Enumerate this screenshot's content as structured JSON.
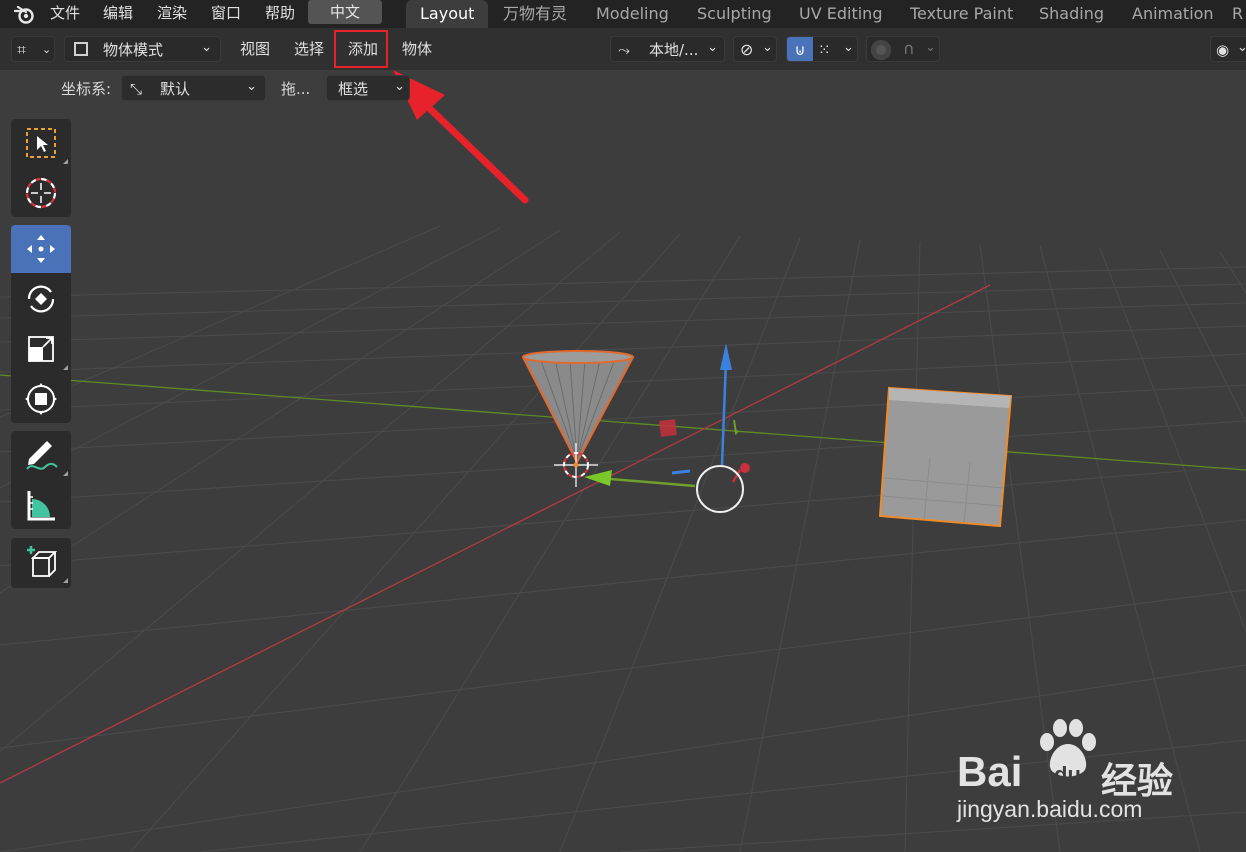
{
  "topbar": {
    "menus": [
      "文件",
      "编辑",
      "渲染",
      "窗口",
      "帮助"
    ],
    "language_button": "中文",
    "workspace_tabs": [
      "Layout",
      "万物有灵",
      "Modeling",
      "Sculpting",
      "UV Editing",
      "Texture Paint",
      "Shading",
      "Animation"
    ],
    "active_tab": "Layout"
  },
  "header": {
    "mode": "物体模式",
    "menus": [
      "视图",
      "选择",
      "添加",
      "物体"
    ],
    "highlighted_menu": "添加",
    "pivot": "本地/..."
  },
  "tool_options": {
    "coord_label": "坐标系:",
    "coord_value": "默认",
    "drag_label": "拖...",
    "drag_value": "框选"
  },
  "toolbar": {
    "tools": [
      "select-box-tool",
      "cursor-tool",
      "move-tool",
      "rotate-tool",
      "scale-tool",
      "transform-tool",
      "annotate-tool",
      "measure-tool",
      "add-cube-tool"
    ],
    "active_tool": "move-tool"
  },
  "watermark": {
    "brand_left": "Bai",
    "brand_du": "du",
    "brand_right": "经验",
    "url": "jingyan.baidu.com"
  },
  "colors": {
    "accent_blue": "#4a72b8",
    "selection_orange": "#f08a2a",
    "axis_red": "#c7303c",
    "axis_green": "#6ea02a",
    "gizmo_blue": "#3a82e0",
    "annotation_red": "#e8222a"
  }
}
